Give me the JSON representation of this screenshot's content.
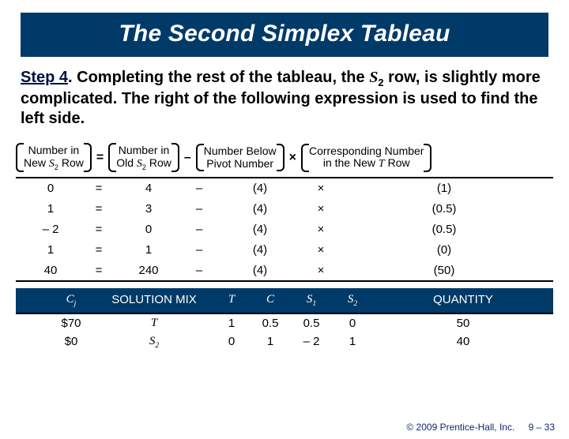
{
  "title": "The Second Simplex Tableau",
  "step": {
    "label": "Step 4",
    "text_a": ". Completing the rest of the tableau, the ",
    "var": "S",
    "sub": "2",
    "text_b": " row, is slightly more complicated. The right of the following expression is used to find the left side."
  },
  "equation": {
    "box1a": "Number in",
    "box1b": "New ",
    "box1c": "S",
    "box1d": "2",
    "box1e": " Row",
    "eq": "=",
    "box2a": "Number in",
    "box2b": "Old ",
    "box2c": "S",
    "box2d": "2",
    "box2e": " Row",
    "minus": "–",
    "box3a": "Number Below",
    "box3b": "Pivot Number",
    "times": "×",
    "box4a": "Corresponding Number",
    "box4b": "in the New ",
    "box4c": "T",
    "box4d": " Row"
  },
  "calc": [
    {
      "r": "0",
      "eq": "=",
      "old": "4",
      "m": "–",
      "below": "(4)",
      "t": "×",
      "corr": "(1)"
    },
    {
      "r": "1",
      "eq": "=",
      "old": "3",
      "m": "–",
      "below": "(4)",
      "t": "×",
      "corr": "(0.5)"
    },
    {
      "r": "– 2",
      "eq": "=",
      "old": "0",
      "m": "–",
      "below": "(4)",
      "t": "×",
      "corr": "(0.5)"
    },
    {
      "r": "1",
      "eq": "=",
      "old": "1",
      "m": "–",
      "below": "(4)",
      "t": "×",
      "corr": "(0)"
    },
    {
      "r": "40",
      "eq": "=",
      "old": "240",
      "m": "–",
      "below": "(4)",
      "t": "×",
      "corr": "(50)"
    }
  ],
  "sol_head": {
    "cj": "C",
    "cj_sub": "j",
    "mix": "SOLUTION MIX",
    "T": "T",
    "C": "C",
    "S1": "S",
    "S1s": "1",
    "S2": "S",
    "S2s": "2",
    "qty": "QUANTITY"
  },
  "sol_rows": [
    {
      "cj": "$70",
      "mix": "T",
      "T": "1",
      "C": "0.5",
      "S1": "0.5",
      "S2": "0",
      "Q": "50"
    },
    {
      "cj": "$0",
      "mix": "S",
      "mix_sub": "2",
      "T": "0",
      "C": "1",
      "S1": "– 2",
      "S2": "1",
      "Q": "40"
    }
  ],
  "footer": {
    "copy": "© 2009 Prentice-Hall, Inc.",
    "page": "9 – 33"
  },
  "chart_data": {
    "type": "table",
    "title": "Second Simplex Tableau — S2 row calculation",
    "formula": "NewS2 = OldS2 – (NumberBelowPivot × NewTRow)",
    "calc_rows": [
      {
        "new": 0,
        "old": 4,
        "below": 4,
        "newT": 1
      },
      {
        "new": 1,
        "old": 3,
        "below": 4,
        "newT": 0.5
      },
      {
        "new": -2,
        "old": 0,
        "below": 4,
        "newT": 0.5
      },
      {
        "new": 1,
        "old": 1,
        "below": 4,
        "newT": 0
      },
      {
        "new": 40,
        "old": 240,
        "below": 4,
        "newT": 50
      }
    ],
    "solution_mix": {
      "columns": [
        "Cj",
        "Mix",
        "T",
        "C",
        "S1",
        "S2",
        "QUANTITY"
      ],
      "rows": [
        {
          "Cj": 70,
          "Mix": "T",
          "T": 1,
          "C": 0.5,
          "S1": 0.5,
          "S2": 0,
          "QUANTITY": 50
        },
        {
          "Cj": 0,
          "Mix": "S2",
          "T": 0,
          "C": 1,
          "S1": -2,
          "S2": 1,
          "QUANTITY": 40
        }
      ]
    }
  }
}
